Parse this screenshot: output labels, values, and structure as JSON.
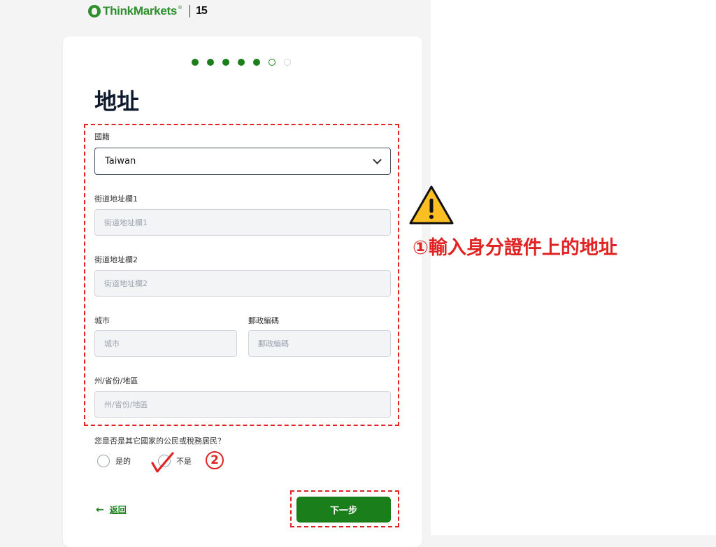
{
  "brand": {
    "logo_text": "ThinkMarkets",
    "logo_reg": "®",
    "anniversary_badge": "15",
    "accent_color": "#1a7f1a",
    "annotation_color": "#e02424"
  },
  "progress": {
    "total_steps": 7,
    "completed": 5,
    "current_step": 6
  },
  "page": {
    "title": "地址"
  },
  "form": {
    "nationality": {
      "label": "國籍",
      "value": "Taiwan",
      "icon": "chevron-down-icon"
    },
    "street1": {
      "label": "街道地址欄1",
      "placeholder": "街道地址欄1"
    },
    "street2": {
      "label": "街道地址欄2",
      "placeholder": "街道地址欄2"
    },
    "city": {
      "label": "城市",
      "placeholder": "城市"
    },
    "postal": {
      "label": "郵政編碼",
      "placeholder": "郵政編碼"
    },
    "state": {
      "label": "州/省份/地區",
      "placeholder": "州/省份/地區"
    },
    "tax_question": {
      "label": "您是否是其它國家的公民或稅務居民？",
      "options": [
        {
          "label": "是的",
          "selected": false
        },
        {
          "label": "不是",
          "selected": true
        }
      ]
    }
  },
  "nav": {
    "back_label": "返回",
    "back_icon": "arrow-left-icon",
    "next_label": "下一步"
  },
  "annotations": {
    "note_1": "①輸入身分證件上的地址",
    "marker_2": "②",
    "warning_icon": "warning-triangle-icon",
    "check_icon": "checkmark-icon"
  }
}
